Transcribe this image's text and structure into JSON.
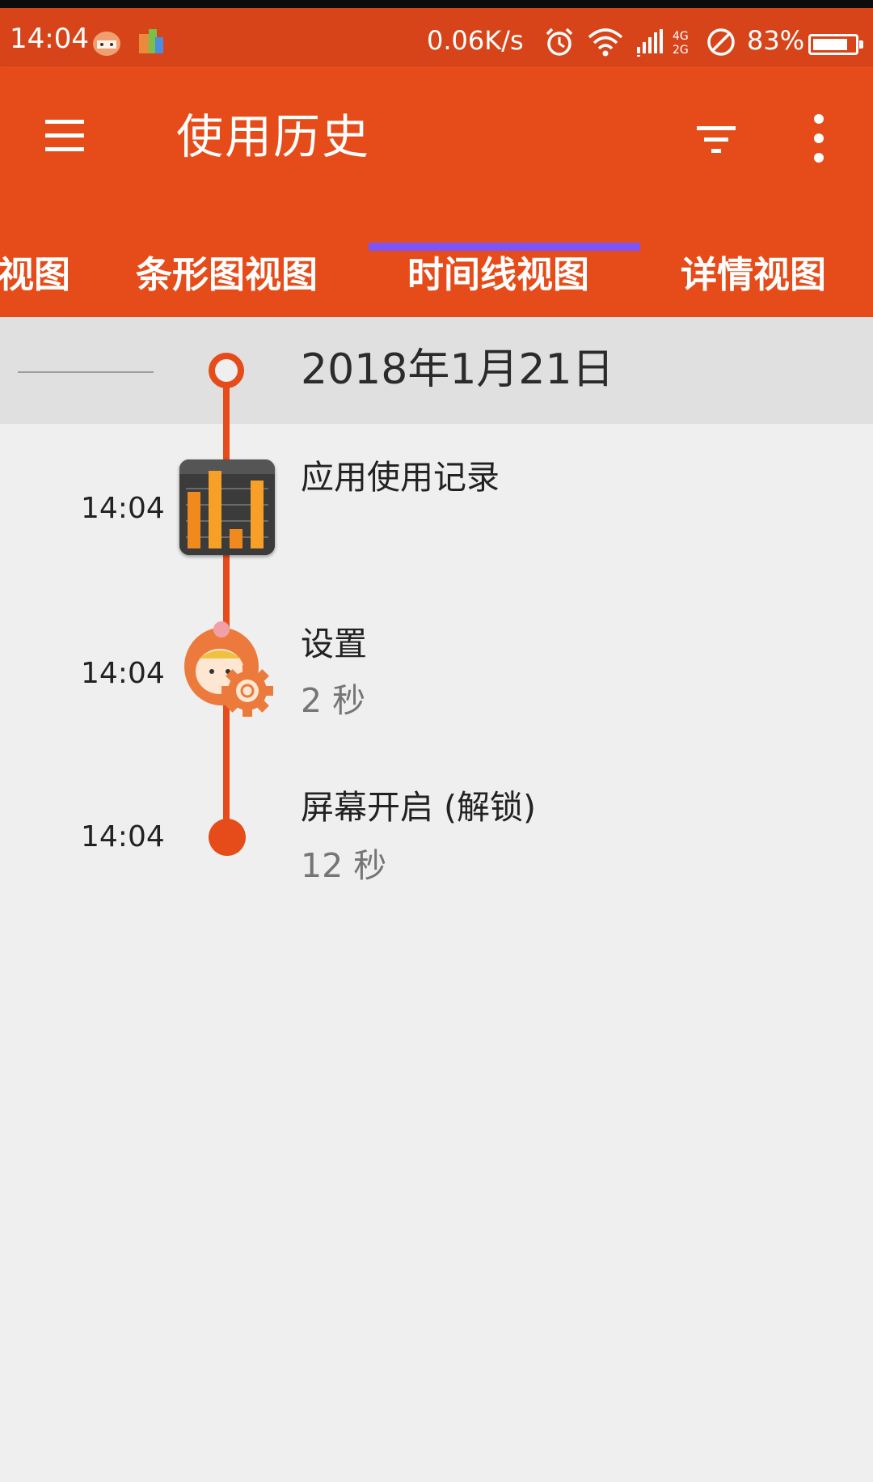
{
  "status_bar": {
    "time": "14:04",
    "net_speed": "0.06K/s",
    "battery": "83%",
    "battery_level": 0.83,
    "icons": [
      "umaru-notification-icon",
      "app-notification-icon",
      "alarm-icon",
      "wifi-icon",
      "signal-4g-2g-icon",
      "do-not-disturb-icon",
      "battery-icon"
    ]
  },
  "app_bar": {
    "title": "使用历史",
    "icons": [
      "menu-icon",
      "filter-icon",
      "more-vert-icon"
    ],
    "color": "#e54c1a"
  },
  "tabs": {
    "items": [
      {
        "label": "视图"
      },
      {
        "label": "条形图视图"
      },
      {
        "label": "时间线视图",
        "selected": true
      },
      {
        "label": "详情视图"
      }
    ],
    "indicator_color": "#7e55f5"
  },
  "timeline": {
    "date": "2018年1月21日",
    "events": [
      {
        "time": "14:04",
        "title": "应用使用记录",
        "icon": "app-usage-icon"
      },
      {
        "time": "14:04",
        "title": "设置",
        "duration": "2 秒",
        "icon": "settings-icon"
      },
      {
        "time": "14:04",
        "title": "屏幕开启 (解锁)",
        "duration": "12 秒",
        "icon": "screen-on-dot"
      }
    ]
  }
}
